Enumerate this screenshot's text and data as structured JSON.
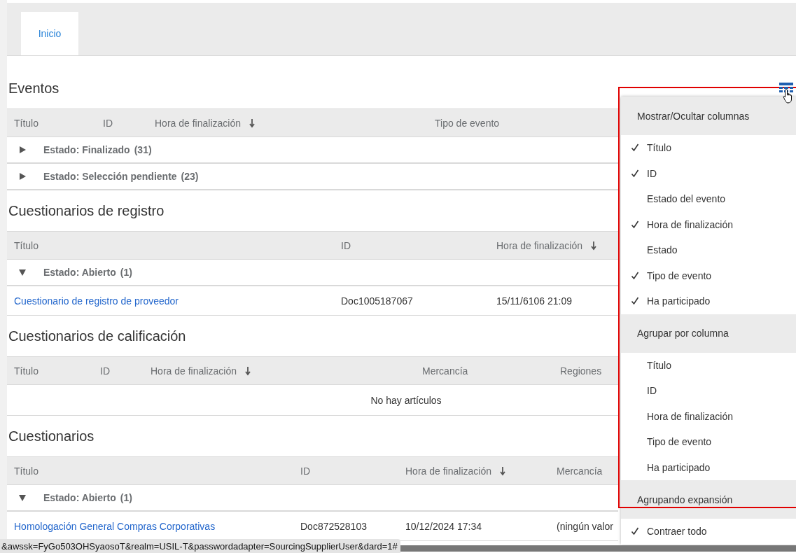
{
  "tabs": [
    {
      "label": "Inicio",
      "selected": true
    }
  ],
  "sections": [
    {
      "title": "Eventos",
      "columns": [
        {
          "label": "Título",
          "sorted": false
        },
        {
          "label": "ID",
          "sorted": false
        },
        {
          "label": "Hora de finalización",
          "sorted": true
        },
        {
          "label": "Tipo de evento",
          "sorted": false
        }
      ],
      "rows": [
        {
          "kind": "group",
          "label": "Estado: Finalizado",
          "count": "(31)",
          "expanded": false
        },
        {
          "kind": "group",
          "label": "Estado: Selección pendiente",
          "count": "(23)",
          "expanded": false
        }
      ]
    },
    {
      "title": "Cuestionarios de registro",
      "columns": [
        {
          "label": "Título",
          "sorted": false
        },
        {
          "label": "ID",
          "sorted": false
        },
        {
          "label": "Hora de finalización",
          "sorted": true
        }
      ],
      "rows": [
        {
          "kind": "group",
          "label": "Estado: Abierto",
          "count": "(1)",
          "expanded": true
        },
        {
          "kind": "item",
          "cells": [
            "Cuestionario de registro de proveedor",
            "Doc1005187067",
            "15/11/6106 21:09"
          ]
        }
      ]
    },
    {
      "title": "Cuestionarios de calificación",
      "columns": [
        {
          "label": "Título",
          "sorted": false
        },
        {
          "label": "ID",
          "sorted": false
        },
        {
          "label": "Hora de finalización",
          "sorted": true
        },
        {
          "label": "Mercancía",
          "sorted": false
        },
        {
          "label": "Regiones",
          "sorted": false
        }
      ],
      "rows": [
        {
          "kind": "empty",
          "label": "No hay artículos"
        }
      ]
    },
    {
      "title": "Cuestionarios",
      "columns": [
        {
          "label": "Título",
          "sorted": false
        },
        {
          "label": "ID",
          "sorted": false
        },
        {
          "label": "Hora de finalización",
          "sorted": true
        },
        {
          "label": "Mercancía",
          "sorted": false
        }
      ],
      "rows": [
        {
          "kind": "group",
          "label": "Estado: Abierto",
          "count": "(1)",
          "expanded": true
        },
        {
          "kind": "item",
          "cells": [
            "Homologación General Compras Corporativas",
            "Doc872528103",
            "10/12/2024 17:34",
            "(ningún valor"
          ]
        }
      ]
    }
  ],
  "column_menu": {
    "sections": [
      {
        "header": "Mostrar/Ocultar columnas",
        "items": [
          {
            "label": "Título",
            "checked": true
          },
          {
            "label": "ID",
            "checked": true
          },
          {
            "label": "Estado del evento",
            "checked": false
          },
          {
            "label": "Hora de finalización",
            "checked": true
          },
          {
            "label": "Estado",
            "checked": false
          },
          {
            "label": "Tipo de evento",
            "checked": true
          },
          {
            "label": "Ha participado",
            "checked": true
          }
        ]
      },
      {
        "header": "Agrupar por columna",
        "items": [
          {
            "label": "Título",
            "checked": false
          },
          {
            "label": "ID",
            "checked": false
          },
          {
            "label": "Hora de finalización",
            "checked": false
          },
          {
            "label": "Tipo de evento",
            "checked": false
          },
          {
            "label": "Ha participado",
            "checked": false
          }
        ]
      },
      {
        "header": "Agrupando expansión",
        "items": [
          {
            "label": "Contraer todo",
            "checked": true
          }
        ]
      }
    ]
  },
  "status_url": "&awssk=FyGo503OHSyaosoT&realm=USIL-T&passwordadapter=SourcingSupplierUser&dard=1#"
}
